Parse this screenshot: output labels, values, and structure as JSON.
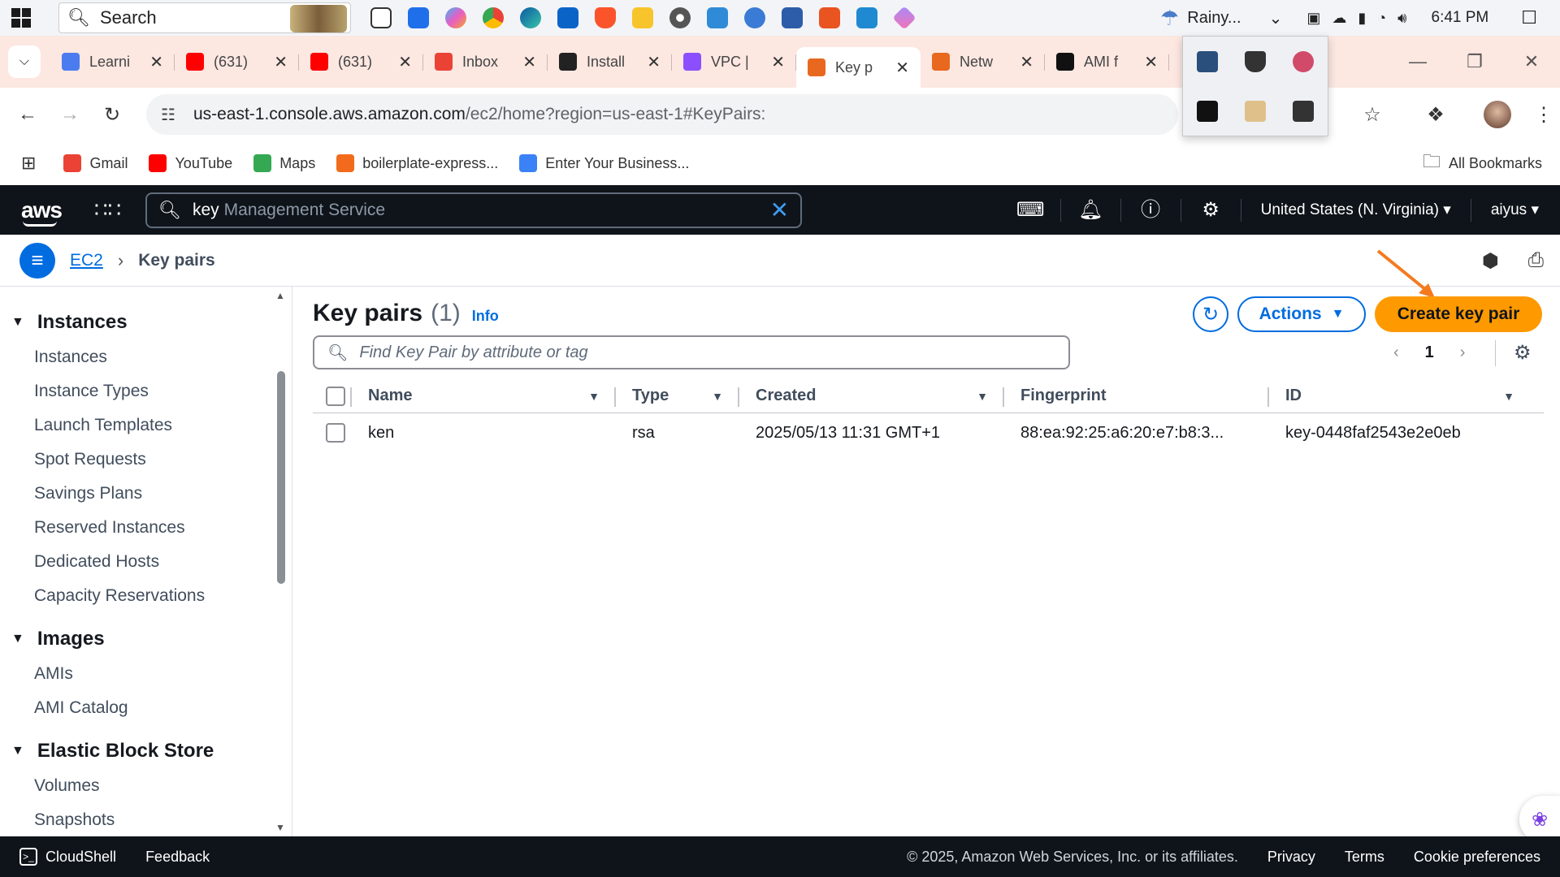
{
  "taskbar": {
    "search_label": "Search",
    "weather": "Rainy...",
    "clock": "6:41 PM"
  },
  "browser": {
    "tabs": [
      {
        "label": "Learni",
        "color": "#4a7cf0"
      },
      {
        "label": "(631)",
        "color": "#ff0000"
      },
      {
        "label": "(631)",
        "color": "#ff0000"
      },
      {
        "label": "Inbox",
        "color": "#ea4335"
      },
      {
        "label": "Install",
        "color": "#222222"
      },
      {
        "label": "VPC |",
        "color": "#8c4fff"
      },
      {
        "label": "Key p",
        "color": "#e8681f"
      },
      {
        "label": "Netw",
        "color": "#e8681f"
      },
      {
        "label": "AMI f",
        "color": "#111111"
      }
    ],
    "url_host": "us-east-1.console.aws.amazon.com",
    "url_path": "/ec2/home?region=us-east-1#KeyPairs:",
    "bookmarks": [
      {
        "label": "Gmail",
        "color": "#ea4335"
      },
      {
        "label": "YouTube",
        "color": "#ff0000"
      },
      {
        "label": "Maps",
        "color": "#34a853"
      },
      {
        "label": "boilerplate-express...",
        "color": "#f26b1d"
      },
      {
        "label": "Enter Your Business...",
        "color": "#3b82f6"
      }
    ],
    "all_bookmarks": "All Bookmarks"
  },
  "aws": {
    "logo": "aws",
    "search_typed": "key",
    "search_hint": "Management Service",
    "region": "United States (N. Virginia)",
    "user": "aiyus"
  },
  "breadcrumb": {
    "service": "EC2",
    "current": "Key pairs"
  },
  "sidebar": {
    "sections": [
      {
        "title": "Instances",
        "items": [
          "Instances",
          "Instance Types",
          "Launch Templates",
          "Spot Requests",
          "Savings Plans",
          "Reserved Instances",
          "Dedicated Hosts",
          "Capacity Reservations"
        ]
      },
      {
        "title": "Images",
        "items": [
          "AMIs",
          "AMI Catalog"
        ]
      },
      {
        "title": "Elastic Block Store",
        "items": [
          "Volumes",
          "Snapshots"
        ]
      }
    ]
  },
  "main": {
    "title": "Key pairs",
    "count": "(1)",
    "info": "Info",
    "actions_label": "Actions",
    "create_label": "Create key pair",
    "filter_placeholder": "Find Key Pair by attribute or tag",
    "page": "1",
    "columns": [
      "Name",
      "Type",
      "Created",
      "Fingerprint",
      "ID"
    ],
    "rows": [
      {
        "name": "ken",
        "type": "rsa",
        "created": "2025/05/13 11:31 GMT+1",
        "fingerprint": "88:ea:92:25:a6:20:e7:b8:3...",
        "id": "key-0448faf2543e2e0eb"
      }
    ]
  },
  "footer": {
    "cloudshell": "CloudShell",
    "feedback": "Feedback",
    "copyright": "© 2025, Amazon Web Services, Inc. or its affiliates.",
    "privacy": "Privacy",
    "terms": "Terms",
    "cookies": "Cookie preferences"
  },
  "colors": {
    "aws_nav": "#0f141a",
    "primary_blue": "#006ce0",
    "orange_cta": "#ff9900",
    "tabstrip": "#fce7e1"
  }
}
